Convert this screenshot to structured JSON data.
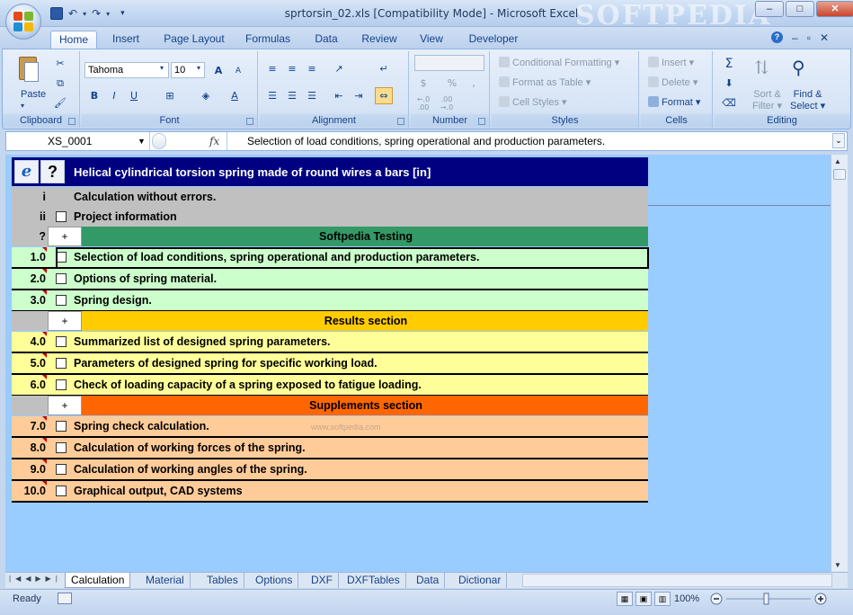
{
  "window": {
    "title": "sprtorsin_02.xls  [Compatibility Mode] - Microsoft Excel",
    "watermark": "SOFTPEDIA",
    "buttons": {
      "minimize": "–",
      "maximize": "□",
      "close": "✕"
    }
  },
  "qat": {
    "save_icon": "save-icon",
    "undo": "↶",
    "redo": "↷"
  },
  "ribbon_tabs": [
    "Home",
    "Insert",
    "Page Layout",
    "Formulas",
    "Data",
    "Review",
    "View",
    "Developer"
  ],
  "ribbon": {
    "clipboard": {
      "label": "Clipboard",
      "paste": "Paste"
    },
    "font": {
      "label": "Font",
      "family": "Tahoma",
      "size": "10",
      "bold": "B",
      "italic": "I",
      "underline": "U",
      "grow": "A",
      "shrink": "A",
      "color": "A"
    },
    "alignment": {
      "label": "Alignment"
    },
    "number": {
      "label": "Number",
      "format": "",
      "currency": "$",
      "percent": "%",
      "comma": ",",
      "inc_decimal": "←.0 .00",
      "dec_decimal": ".00 →.0"
    },
    "styles": {
      "label": "Styles",
      "conditional": "Conditional Formatting",
      "format_table": "Format as Table",
      "cell_styles": "Cell Styles"
    },
    "cells": {
      "label": "Cells",
      "insert": "Insert",
      "delete": "Delete",
      "format": "Format"
    },
    "editing": {
      "label": "Editing",
      "sum": "Σ",
      "sort": "Sort &",
      "filter": "Filter",
      "find": "Find &",
      "select": "Select"
    }
  },
  "formula_bar": {
    "name_box": "XS_0001",
    "fx": "fx",
    "content": "Selection of load conditions, spring operational and production parameters."
  },
  "sheet": {
    "header": {
      "ie": "e",
      "help": "?",
      "title": "Helical cylindrical torsion spring made of round wires a bars [in]"
    },
    "rows": [
      {
        "num": "i",
        "text": "Calculation without errors.",
        "bg": "#c0c0c0",
        "checkbox": false
      },
      {
        "num": "ii",
        "text": "Project information",
        "bg": "#c0c0c0",
        "checkbox": true
      },
      {
        "num": "?",
        "text": "Softpedia Testing",
        "bg": "#339966",
        "section": true
      },
      {
        "num": "1.0",
        "text": "Selection of load conditions, spring operational and production parameters.",
        "bg": "#ccffcc",
        "checkbox": true
      },
      {
        "num": "2.0",
        "text": "Options of spring material.",
        "bg": "#ccffcc",
        "checkbox": true
      },
      {
        "num": "3.0",
        "text": "Spring design.",
        "bg": "#ccffcc",
        "checkbox": true
      },
      {
        "num": "",
        "text": "Results section",
        "bg": "#ffcc00",
        "section": true
      },
      {
        "num": "4.0",
        "text": "Summarized list of designed spring parameters.",
        "bg": "#ffff99",
        "checkbox": true
      },
      {
        "num": "5.0",
        "text": "Parameters of designed spring for specific working load.",
        "bg": "#ffff99",
        "checkbox": true
      },
      {
        "num": "6.0",
        "text": "Check of loading capacity of a spring exposed to fatigue loading.",
        "bg": "#ffff99",
        "checkbox": true
      },
      {
        "num": "",
        "text": "Supplements section",
        "bg": "#ff6600",
        "section": true
      },
      {
        "num": "7.0",
        "text": "Spring check calculation.",
        "bg": "#ffcc99",
        "checkbox": true
      },
      {
        "num": "8.0",
        "text": "Calculation of working forces of the spring.",
        "bg": "#ffcc99",
        "checkbox": true
      },
      {
        "num": "9.0",
        "text": "Calculation of working angles of the spring.",
        "bg": "#ffcc99",
        "checkbox": true
      },
      {
        "num": "10.0",
        "text": "Graphical output, CAD systems",
        "bg": "#ffcc99",
        "checkbox": true
      }
    ],
    "plus": "+",
    "watermark_url": "www.softpedia.com"
  },
  "sheet_tabs": [
    "Calculation",
    "Material",
    "Tables",
    "Options",
    "DXF",
    "DXFTables",
    "Data",
    "Dictionar"
  ],
  "status": {
    "ready": "Ready",
    "zoom": "100%"
  }
}
